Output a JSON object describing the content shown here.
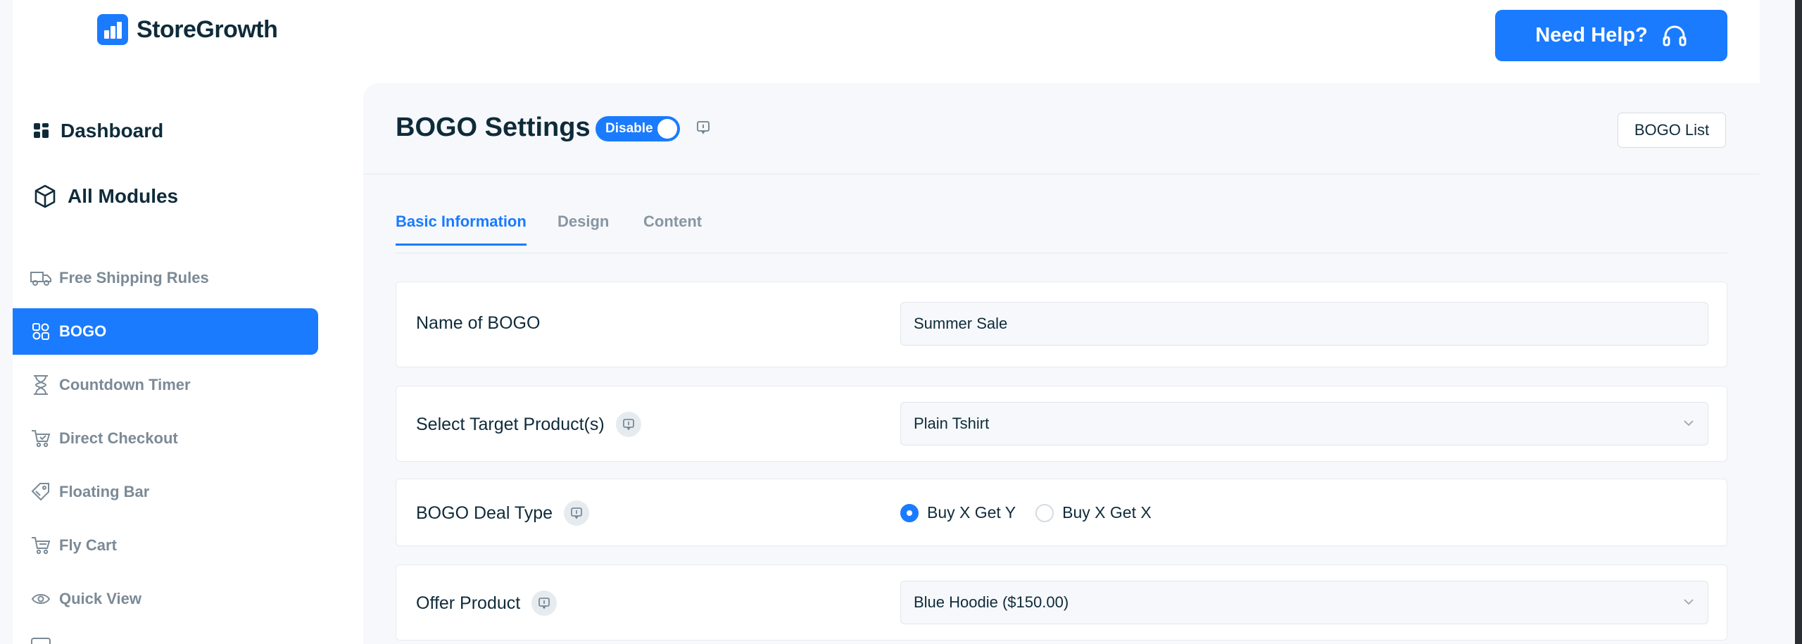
{
  "brand": {
    "name": "StoreGrowth"
  },
  "header": {
    "help_label": "Need Help?"
  },
  "sidebar": {
    "main": [
      {
        "label": "Dashboard",
        "icon": "dashboard-grid-icon"
      },
      {
        "label": "All Modules",
        "icon": "cube-icon"
      }
    ],
    "items": [
      {
        "label": "Free Shipping Rules",
        "icon": "truck-icon"
      },
      {
        "label": "BOGO",
        "icon": "bogo-shapes-icon",
        "active": true
      },
      {
        "label": "Countdown Timer",
        "icon": "hourglass-icon"
      },
      {
        "label": "Direct Checkout",
        "icon": "cart-check-icon"
      },
      {
        "label": "Floating Bar",
        "icon": "tag-icon"
      },
      {
        "label": "Fly Cart",
        "icon": "cart-icon"
      },
      {
        "label": "Quick View",
        "icon": "eye-icon"
      }
    ]
  },
  "page": {
    "title": "BOGO Settings",
    "toggle_label": "Disable",
    "list_button": "BOGO List"
  },
  "tabs": [
    {
      "label": "Basic Information",
      "active": true
    },
    {
      "label": "Design"
    },
    {
      "label": "Content"
    }
  ],
  "form": {
    "name": {
      "label": "Name of BOGO",
      "value": "Summer Sale"
    },
    "target": {
      "label": "Select Target Product(s)",
      "value": "Plain Tshirt"
    },
    "deal_type": {
      "label": "BOGO Deal Type",
      "options": [
        {
          "label": "Buy X Get Y",
          "checked": true
        },
        {
          "label": "Buy X Get X",
          "checked": false
        }
      ]
    },
    "offer": {
      "label": "Offer Product",
      "value": "Blue Hoodie ($150.00)"
    }
  },
  "colors": {
    "accent": "#1a7bff",
    "text": "#0f2b3a",
    "muted": "#7b8a96",
    "panel": "#f6f8fb"
  }
}
